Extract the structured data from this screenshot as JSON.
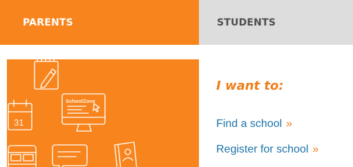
{
  "tabs": [
    {
      "label": "PARENTS",
      "active": true
    },
    {
      "label": "STUDENTS",
      "active": false
    }
  ],
  "promo": {
    "screen_logo_text": "SchoolZone",
    "calendar_text": "31"
  },
  "main": {
    "heading": "I want to:",
    "links": [
      {
        "label": "Find a school",
        "arrow": "»"
      },
      {
        "label": "Register for school",
        "arrow": "»"
      }
    ]
  },
  "colors": {
    "accent_orange": "#f7841c",
    "link_blue": "#1a73a8",
    "inactive_tab_gray": "#dddddd"
  }
}
